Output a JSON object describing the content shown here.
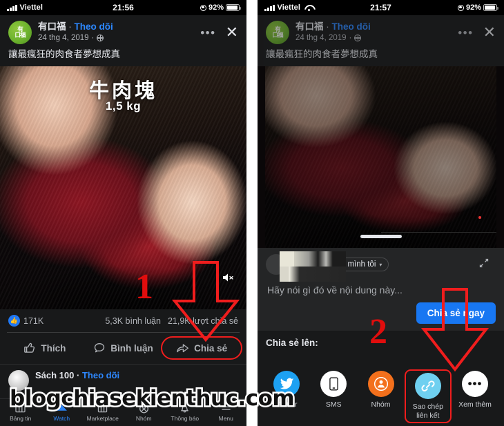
{
  "left": {
    "status": {
      "carrier": "Viettel",
      "time": "21:56",
      "battery": "92%",
      "signal_icon": "signal-bars-icon",
      "battery_icon": "battery-icon",
      "location_icon": "location-services-icon"
    },
    "post": {
      "page_name": "有口福",
      "separator": "·",
      "follow_label": "Theo dõi",
      "date": "24 thg 4, 2019",
      "privacy_icon": "globe-icon",
      "more_icon": "more-options-icon",
      "close_icon": "close-icon",
      "caption": "讓最瘋狂的肉食者夢想成真",
      "avatar_line1": "有",
      "avatar_line2": "口福"
    },
    "media": {
      "overlay_title": "牛肉塊",
      "overlay_subtitle": "1,5 kg",
      "mute_icon": "muted-speaker-icon"
    },
    "counts": {
      "likes": "171K",
      "like_icon": "thumbs-up-filled-icon",
      "comments": "5,3K bình luận",
      "shares": "21,9K lượt chia sẻ"
    },
    "actions": [
      {
        "label": "Thích",
        "icon": "thumbs-up-outline-icon",
        "highlighted": false
      },
      {
        "label": "Bình luận",
        "icon": "comment-bubble-icon",
        "highlighted": false
      },
      {
        "label": "Chia sẻ",
        "icon": "share-arrow-icon",
        "highlighted": true
      }
    ],
    "next_post": {
      "name": "Sách 100",
      "separator": "·",
      "follow_label": "Theo dõi"
    },
    "bottom_nav": [
      {
        "label": "Bảng tin",
        "icon": "news-feed-icon",
        "active": false
      },
      {
        "label": "Watch",
        "icon": "watch-play-icon",
        "active": true
      },
      {
        "label": "Marketplace",
        "icon": "marketplace-storefront-icon",
        "active": false
      },
      {
        "label": "Nhóm",
        "icon": "groups-icon",
        "active": false
      },
      {
        "label": "Thông báo",
        "icon": "notifications-bell-icon",
        "active": false
      },
      {
        "label": "Menu",
        "icon": "hamburger-menu-icon",
        "active": false
      }
    ],
    "annotation": {
      "number": "1",
      "arrow_icon": "red-down-arrow-outline"
    }
  },
  "right": {
    "status": {
      "carrier": "Viettel",
      "time": "21:57",
      "battery": "92%",
      "wifi_icon": "wifi-icon"
    },
    "post": {
      "page_name": "有口福",
      "separator": "·",
      "follow_label": "Theo dõi",
      "date": "24 thg 4, 2019",
      "caption": "讓最瘋狂的肉食者夢想成真",
      "more_icon": "more-options-icon",
      "close_icon": "close-icon"
    },
    "composer": {
      "author_name_redacted": "",
      "audience_chip": "Chỉ mình tôi",
      "audience_chip_icon": "lock-icon",
      "audience_caret": "▾",
      "feed_chip_caret": "▾",
      "expand_icon": "expand-icon",
      "placeholder": "Hãy nói gì đó về nội dung này...",
      "share_button": "Chia sẻ ngay"
    },
    "share_section": {
      "title": "Chia sẻ lên:",
      "targets": [
        {
          "label": "Twitter",
          "icon": "twitter-bird-icon",
          "color": "#1da1f2",
          "highlighted": false
        },
        {
          "label": "SMS",
          "icon": "sms-phone-icon",
          "color": "#ffffff",
          "highlighted": false
        },
        {
          "label": "Nhóm",
          "icon": "groups-icon",
          "color": "#f3701c",
          "highlighted": false
        },
        {
          "label": "Sao chép\nliên kết",
          "label_line1": "Sao chép",
          "label_line2": "liên kết",
          "icon": "copy-link-chain-icon",
          "color": "#6fd0f0",
          "highlighted": true
        },
        {
          "label": "Xem thêm",
          "icon": "more-dots-icon",
          "color": "#ffffff",
          "highlighted": false
        }
      ]
    },
    "annotation": {
      "number": "2",
      "arrow_icon": "red-down-arrow-outline"
    }
  },
  "watermark": {
    "text": "blogchiasekienthuc.com"
  },
  "theme": {
    "bg": "#18191a",
    "surface": "#242526",
    "text_primary": "#e4e6eb",
    "text_secondary": "#b0b3b8",
    "accent_blue": "#2d88ff",
    "button_blue": "#1877f2",
    "annotation_red": "#e00d0d"
  }
}
